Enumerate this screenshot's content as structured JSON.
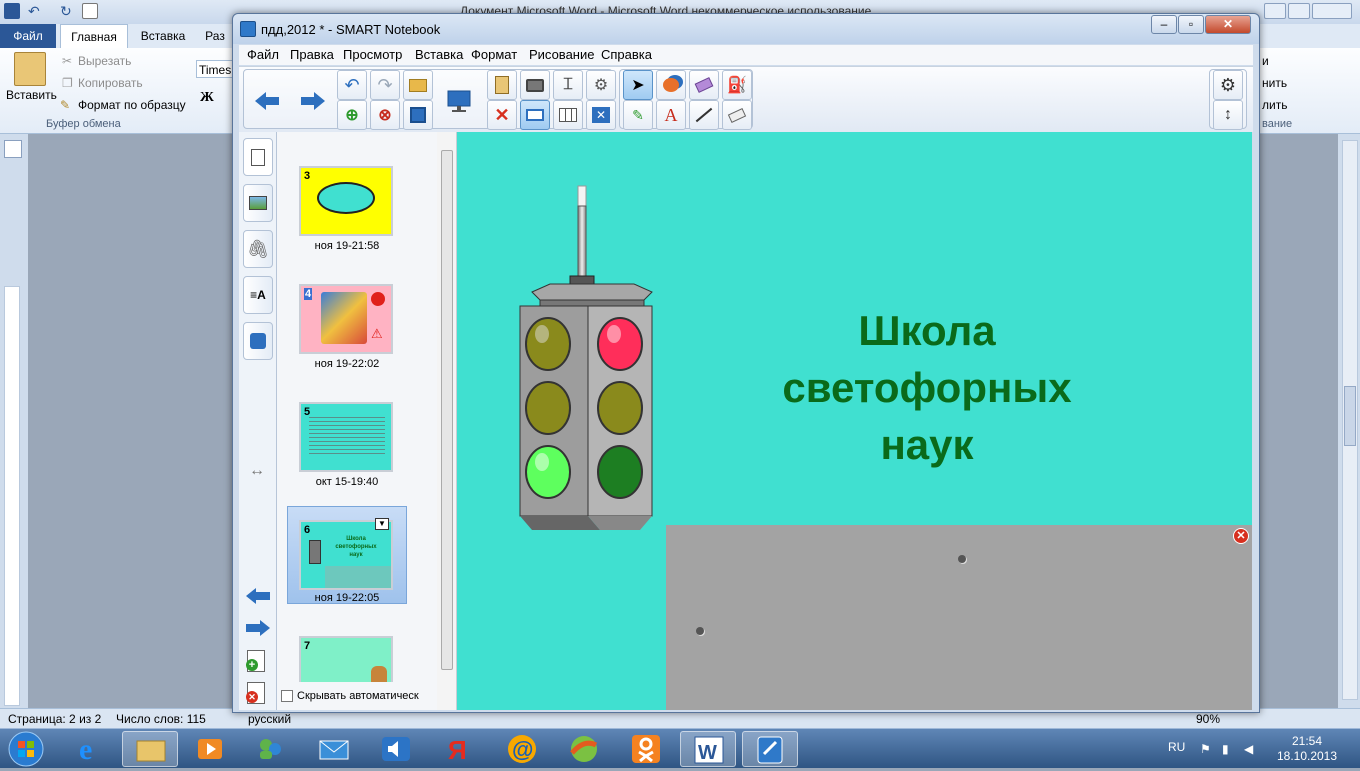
{
  "word": {
    "title": "Документ Microsoft Word - Microsoft Word некоммерческое использование",
    "tabs": [
      "Файл",
      "Главная",
      "Вставка",
      "Раз"
    ],
    "clipboard": {
      "paste": "Вставить",
      "cut": "Вырезать",
      "copy": "Копировать",
      "format_painter": "Формат по образцу",
      "group_label": "Буфер обмена"
    },
    "font_name": "Times N",
    "bold": "Ж",
    "right_fragments": [
      "и",
      "нить",
      "лить",
      "вание"
    ],
    "status": {
      "page": "Страница: 2 из 2",
      "words": "Число слов: 115",
      "lang": "русский",
      "zoom": "90%"
    }
  },
  "notebook": {
    "title": "пдд,2012 * - SMART Notebook",
    "menu": [
      "Файл",
      "Правка",
      "Просмотр",
      "Вставка",
      "Формат",
      "Рисование",
      "Справка"
    ],
    "sorter": {
      "pages": [
        {
          "number": "3",
          "label": "ноя 19-21:58"
        },
        {
          "number": "4",
          "label": "ноя 19-22:02"
        },
        {
          "number": "5",
          "label": "окт 15-19:40"
        },
        {
          "number": "6",
          "label": "ноя 19-22:05",
          "title_lines": [
            "Школа",
            "светофорных",
            "наук"
          ]
        },
        {
          "number": "7",
          "label": ""
        }
      ],
      "autohide_label": "Скрывать автоматическ"
    },
    "slide": {
      "title_lines": [
        "Школа",
        "светофорных",
        "наук"
      ],
      "background": "#40e0d0",
      "title_color": "#0a6a1a"
    }
  },
  "taskbar": {
    "lang": "RU",
    "time": "21:54",
    "date": "18.10.2013"
  }
}
